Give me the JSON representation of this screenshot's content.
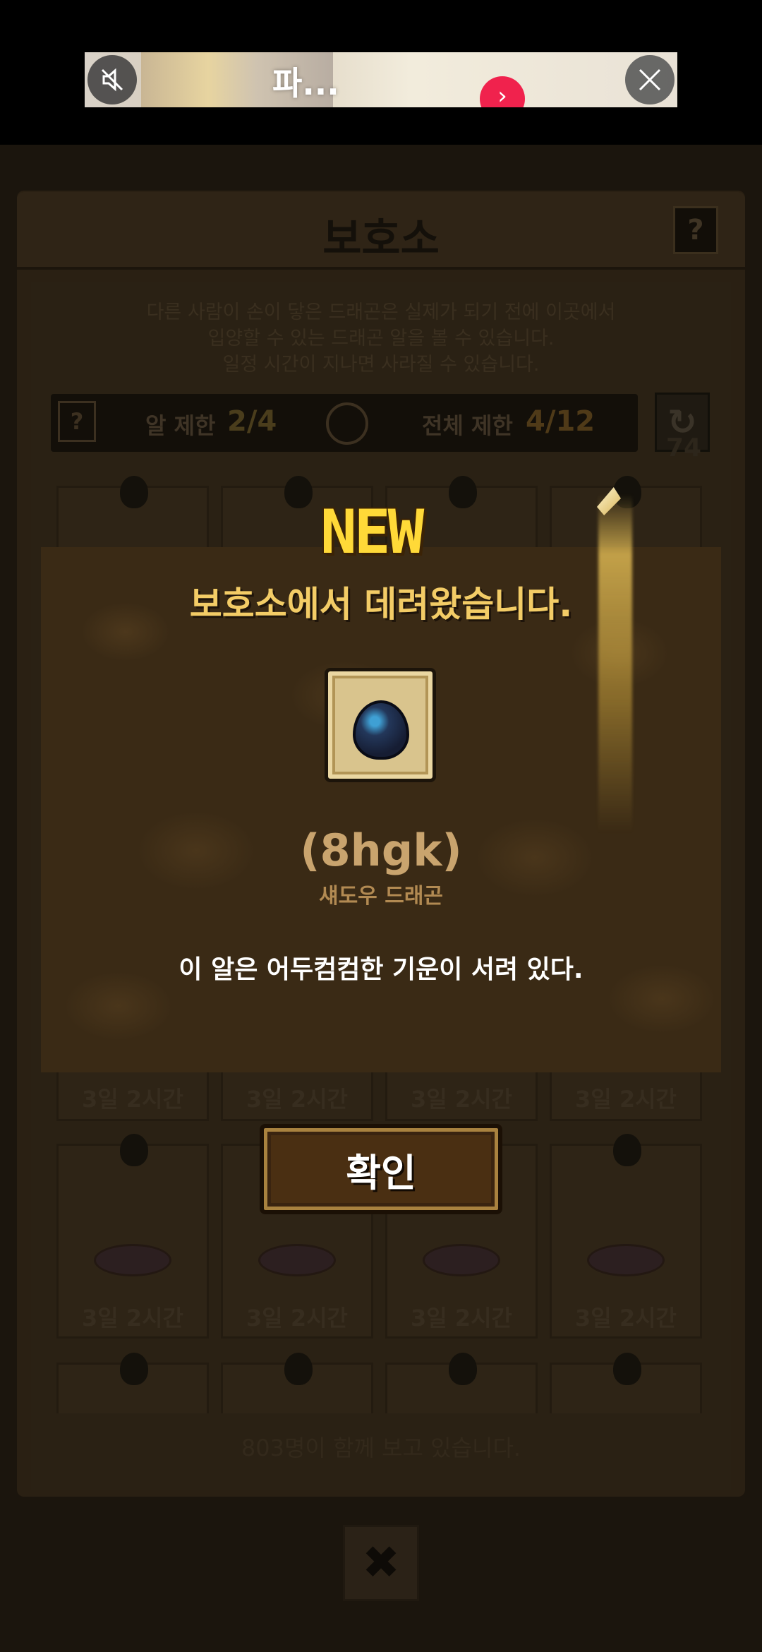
{
  "ad": {
    "title": "파...",
    "go_glyph": "›",
    "mute_icon": "speaker-muted",
    "close_icon": "close-x"
  },
  "shelter": {
    "title": "보호소",
    "help_label": "?",
    "description_lines": [
      "다른 사람이 손이 닿은 드래곤은 실제가 되기 전에 이곳에서",
      "입양할 수 있는 드래곤 알을 볼 수 있습니다.",
      "일정 시간이 지나면 사라질 수 있습니다."
    ],
    "egg_limit_label": "알 제한",
    "egg_limit_value": "2/4",
    "total_limit_label": "전체 제한",
    "total_limit_value": "4/12",
    "refresh_count": "74",
    "slot_timer": "3일 2시간",
    "watchers_text": "803명이 함께 보고 있습니다.",
    "close_glyph": "✖"
  },
  "popup": {
    "badge": "NEW",
    "heading": "보호소에서 데려왔습니다.",
    "egg_name": "(8hgk)",
    "egg_type": "섀도우 드래곤",
    "egg_description": "이 알은 어두컴컴한 기운이 서려 있다.",
    "confirm_label": "확인"
  },
  "colors": {
    "heading_gold": "#f3cc66",
    "badge_yellow": "#ffd938",
    "ad_go_red": "#f0224d",
    "popup_bg": "#3a2a15"
  }
}
